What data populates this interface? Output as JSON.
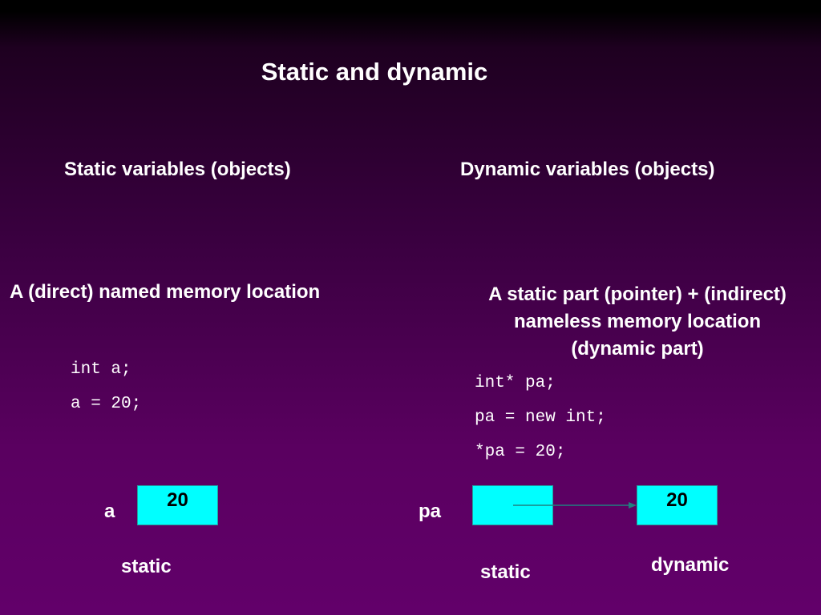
{
  "slide": {
    "title": "Static and dynamic",
    "left": {
      "heading": "Static variables (objects)",
      "description": "A (direct) named memory location",
      "code": [
        "int a;",
        "a = 20;"
      ],
      "variable_label": "a",
      "box_value": "20",
      "caption": "static"
    },
    "right": {
      "heading": "Dynamic variables (objects)",
      "description_lines": [
        "A static part (pointer) + (indirect)",
        "nameless memory location",
        "(dynamic part)"
      ],
      "code": [
        "int* pa;",
        "pa = new int;",
        "*pa = 20;"
      ],
      "variable_label": "pa",
      "dynamic_box_value": "20",
      "caption_static": "static",
      "caption_dynamic": "dynamic"
    }
  },
  "colors": {
    "box_fill": "#00ffff",
    "arrow": "#208080",
    "text": "#ffffff"
  }
}
